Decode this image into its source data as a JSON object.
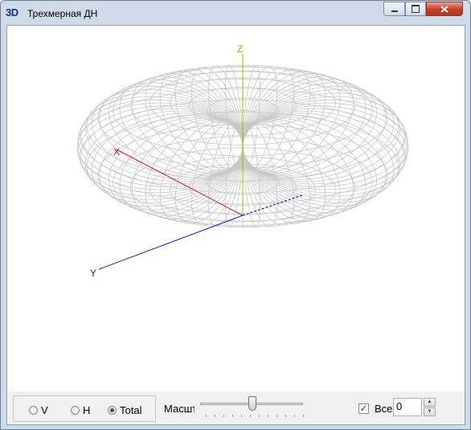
{
  "window": {
    "app_icon": "3D",
    "title": "Трехмерная ДН",
    "controls": [
      "minimize-icon",
      "maximize-icon",
      "close-icon"
    ]
  },
  "viewport": {
    "axes": {
      "x_label": "X",
      "y_label": "Y",
      "z_label": "Z"
    },
    "axis_colors": {
      "x": "#cc2020",
      "y": "#1020c0",
      "z": "#a8b400",
      "mesh": "#c8c8c8"
    }
  },
  "bottom_bar": {
    "polarization": {
      "options": [
        "V",
        "H",
        "Total"
      ],
      "selected": "Total"
    },
    "scale_label": "Масштаб",
    "scale_value": 0.55,
    "all_checkbox": {
      "label": "Все",
      "checked": true
    },
    "spin_value": "0"
  }
}
